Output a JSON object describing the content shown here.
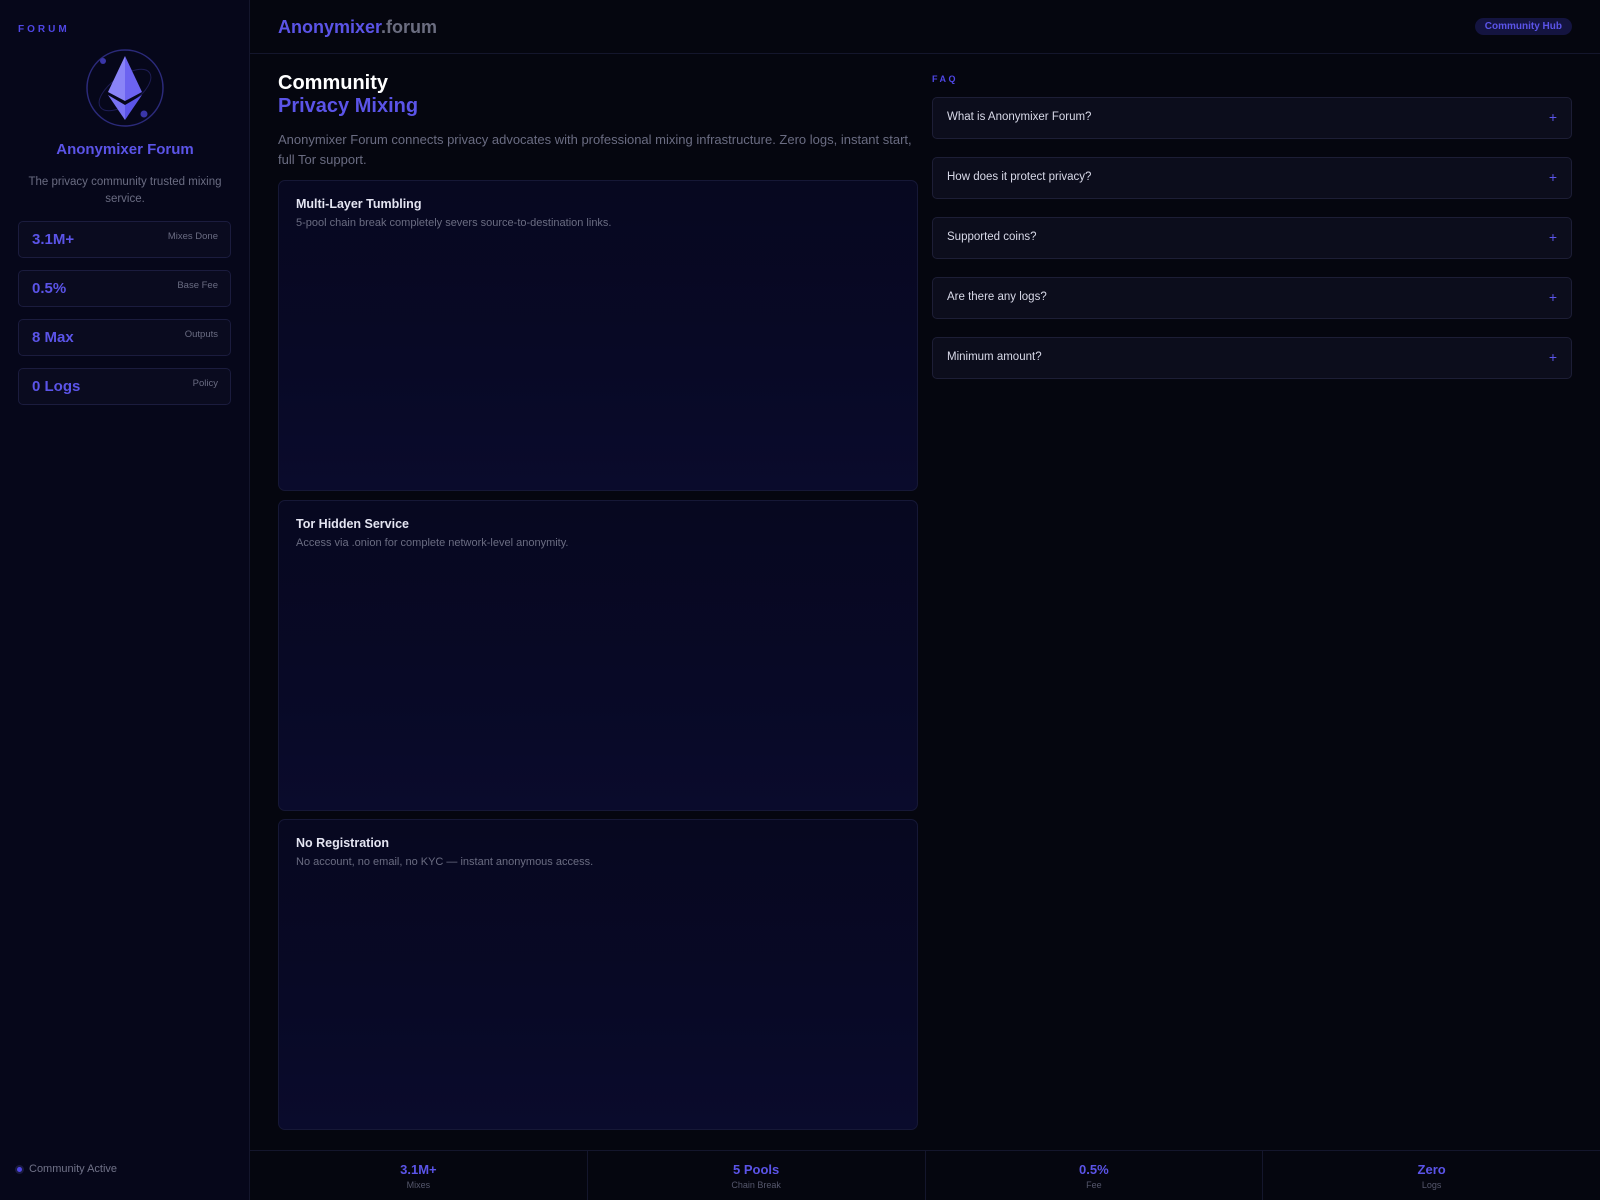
{
  "sidebar": {
    "kicker": "FORUM",
    "logo_icon": "ethereum-logo-icon",
    "title": "Anonymixer Forum",
    "description": "The privacy community trusted mixing service.",
    "stats": [
      {
        "value": "3.1M+",
        "label": "Mixes Done"
      },
      {
        "value": "0.5%",
        "label": "Base Fee"
      },
      {
        "value": "8 Max",
        "label": "Outputs"
      },
      {
        "value": "0 Logs",
        "label": "Policy"
      }
    ],
    "status": "Community Active"
  },
  "header": {
    "brand_primary": "Anonymixer",
    "brand_secondary": ".forum",
    "badge": "Community Hub"
  },
  "hero": {
    "title_line1": "Community",
    "title_line2": "Privacy Mixing",
    "description": "Anonymixer Forum connects privacy advocates with professional mixing infrastructure. Zero logs, instant start, full Tor support."
  },
  "features": [
    {
      "title": "Multi-Layer Tumbling",
      "description": "5-pool chain break completely severs source-to-destination links."
    },
    {
      "title": "Tor Hidden Service",
      "description": "Access via .onion for complete network-level anonymity."
    },
    {
      "title": "No Registration",
      "description": "No account, no email, no KYC — instant anonymous access."
    }
  ],
  "faq": {
    "label": "FAQ",
    "expand_icon": "plus-icon",
    "items": [
      {
        "question": "What is Anonymixer Forum?",
        "toggle": "+"
      },
      {
        "question": "How does it protect privacy?",
        "toggle": "+"
      },
      {
        "question": "Supported coins?",
        "toggle": "+"
      },
      {
        "question": "Are there any logs?",
        "toggle": "+"
      },
      {
        "question": "Minimum amount?",
        "toggle": "+"
      }
    ]
  },
  "footer": [
    {
      "value": "3.1M+",
      "label": "Mixes"
    },
    {
      "value": "5 Pools",
      "label": "Chain Break"
    },
    {
      "value": "0.5%",
      "label": "Fee"
    },
    {
      "value": "Zero",
      "label": "Logs"
    }
  ],
  "colors": {
    "accent": "#5b54e8",
    "background": "#05060f",
    "muted_text": "#6a6c82"
  }
}
